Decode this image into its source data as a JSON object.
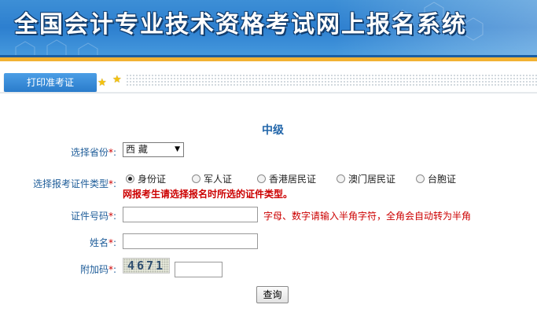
{
  "banner": {
    "title": "全国会计专业技术资格考试网上报名系统"
  },
  "tabs": [
    {
      "label": "打印准考证"
    }
  ],
  "form": {
    "level": "中级",
    "province": {
      "label": "选择省份",
      "required_mark": "*",
      "colon": ":",
      "value": "西 藏"
    },
    "id_type": {
      "label": "选择报考证件类型",
      "required_mark": "*",
      "colon": ":",
      "options": [
        "身份证",
        "军人证",
        "香港居民证",
        "澳门居民证",
        "台胞证"
      ],
      "selected": "身份证",
      "warning": "网报考生请选择报名时所选的证件类型。"
    },
    "id_number": {
      "label": "证件号码",
      "required_mark": "*",
      "colon": ":",
      "value": "",
      "hint": "字母、数字请输入半角字符，全角会自动转为半角"
    },
    "name": {
      "label": "姓名",
      "required_mark": "*",
      "colon": ":",
      "value": ""
    },
    "captcha": {
      "label": "附加码",
      "required_mark": "*",
      "colon": ":",
      "image_text": "4671",
      "value": ""
    },
    "submit_label": "查询"
  },
  "colors": {
    "banner": "#2d7fcf",
    "accent_yellow": "#f2b233",
    "label_blue": "#1f5d99",
    "warning_red": "#cc0000"
  }
}
